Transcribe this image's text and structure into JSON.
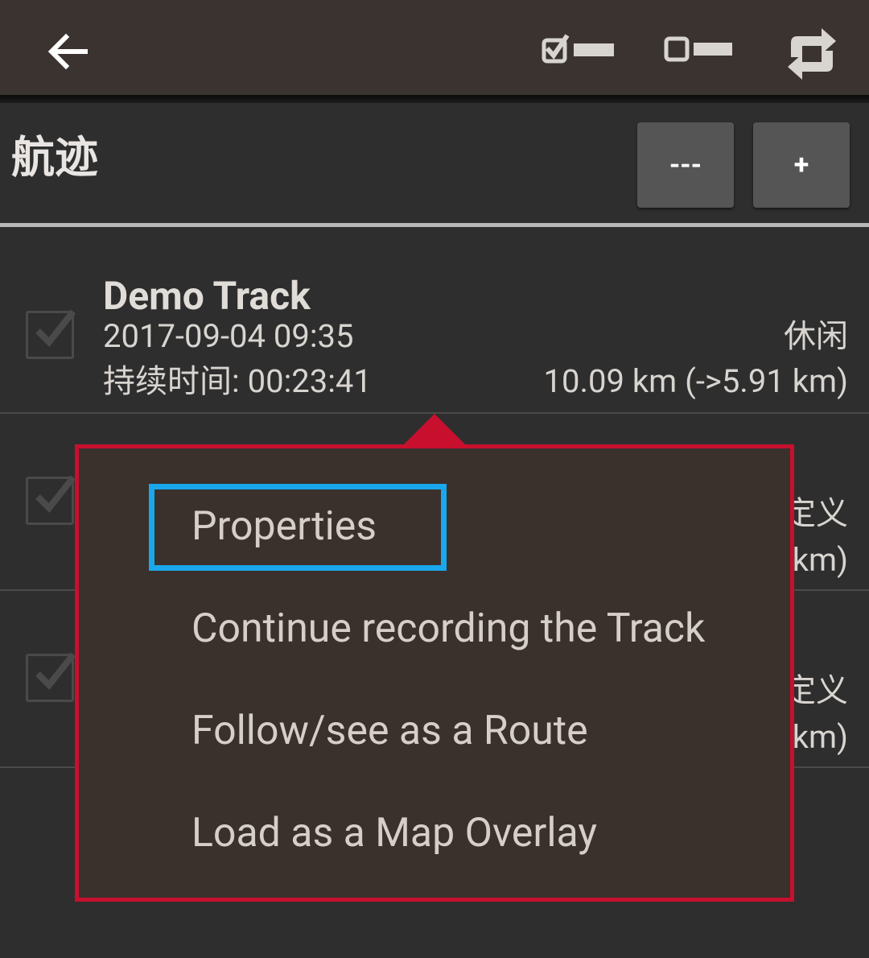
{
  "topbar": {
    "back_icon": "arrow-left-icon",
    "select_all_icon": "check-all-icon",
    "deselect_all_icon": "uncheck-all-icon",
    "sync_icon": "sync-icon"
  },
  "section": {
    "title": "航迹",
    "collapse_label": "---",
    "add_label": "+"
  },
  "tracks": [
    {
      "name": "Demo Track",
      "date": "2017-09-04 09:35",
      "category": "休闲",
      "duration": "持续时间: 00:23:41",
      "distance": "10.09 km (->5.91 km)"
    },
    {
      "name": "",
      "partial_category": "定义",
      "partial_distance": "km)"
    },
    {
      "name": "",
      "partial_category": "定义",
      "partial_distance": "km)"
    }
  ],
  "context_menu": {
    "items": [
      "Properties",
      "Continue recording the Track",
      "Follow/see as a Route",
      "Load as a Map Overlay"
    ]
  },
  "colors": {
    "topbar": "#3a3330",
    "background": "#2e2e2e",
    "menu_border": "#c8102e",
    "highlight": "#1aa7ec"
  }
}
